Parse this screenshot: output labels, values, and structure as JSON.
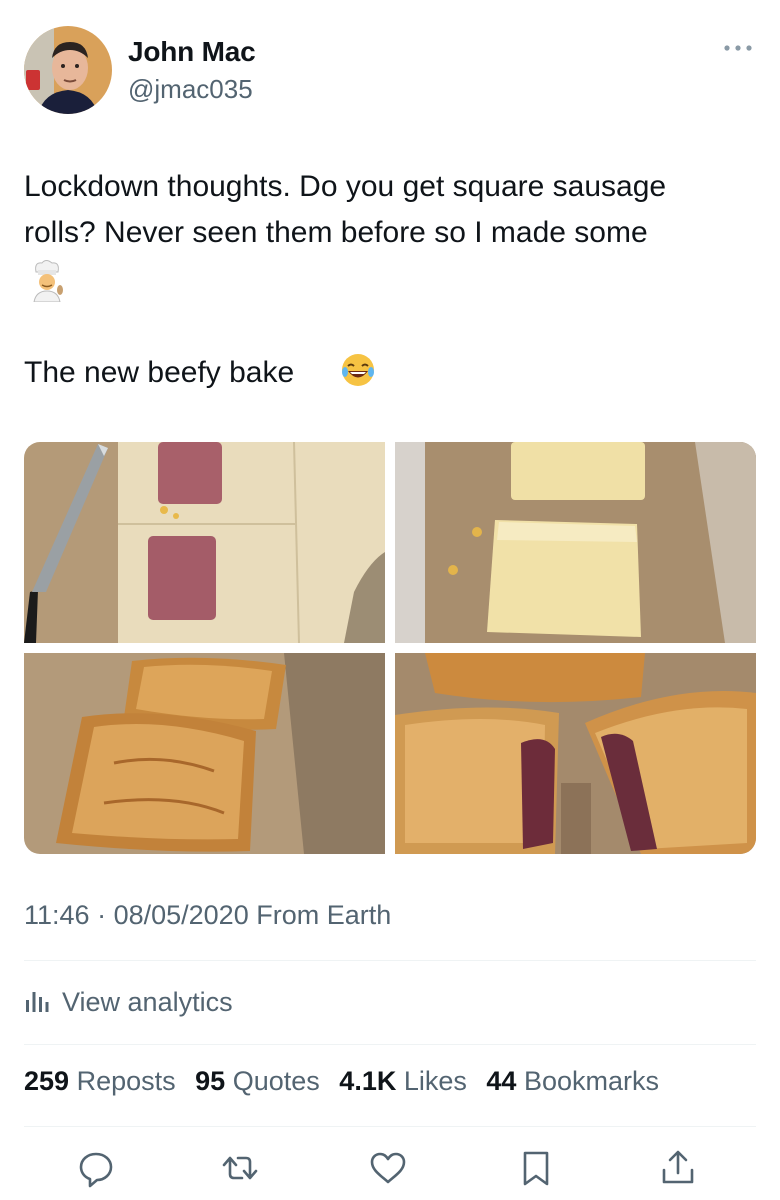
{
  "author": {
    "display_name": "John Mac",
    "handle": "@jmac035"
  },
  "tweet": {
    "text_line1": "Lockdown thoughts. Do you get square sausage",
    "text_line2": "rolls? Never seen them before so I made some",
    "text_line3": "The new beefy bake"
  },
  "meta": {
    "time": "11:46",
    "date": "08/05/2020",
    "source": "From Earth"
  },
  "analytics_label": "View analytics",
  "stats": {
    "reposts_count": "259",
    "reposts_label": "Reposts",
    "quotes_count": "95",
    "quotes_label": "Quotes",
    "likes_count": "4.1K",
    "likes_label": "Likes",
    "bookmarks_count": "44",
    "bookmarks_label": "Bookmarks"
  },
  "colors": {
    "text_primary": "#0f1419",
    "text_secondary": "#536471",
    "divider": "#eff3f4"
  },
  "icons": [
    "more-icon",
    "analytics-icon",
    "reply-icon",
    "repost-icon",
    "like-icon",
    "bookmark-icon",
    "share-icon"
  ]
}
